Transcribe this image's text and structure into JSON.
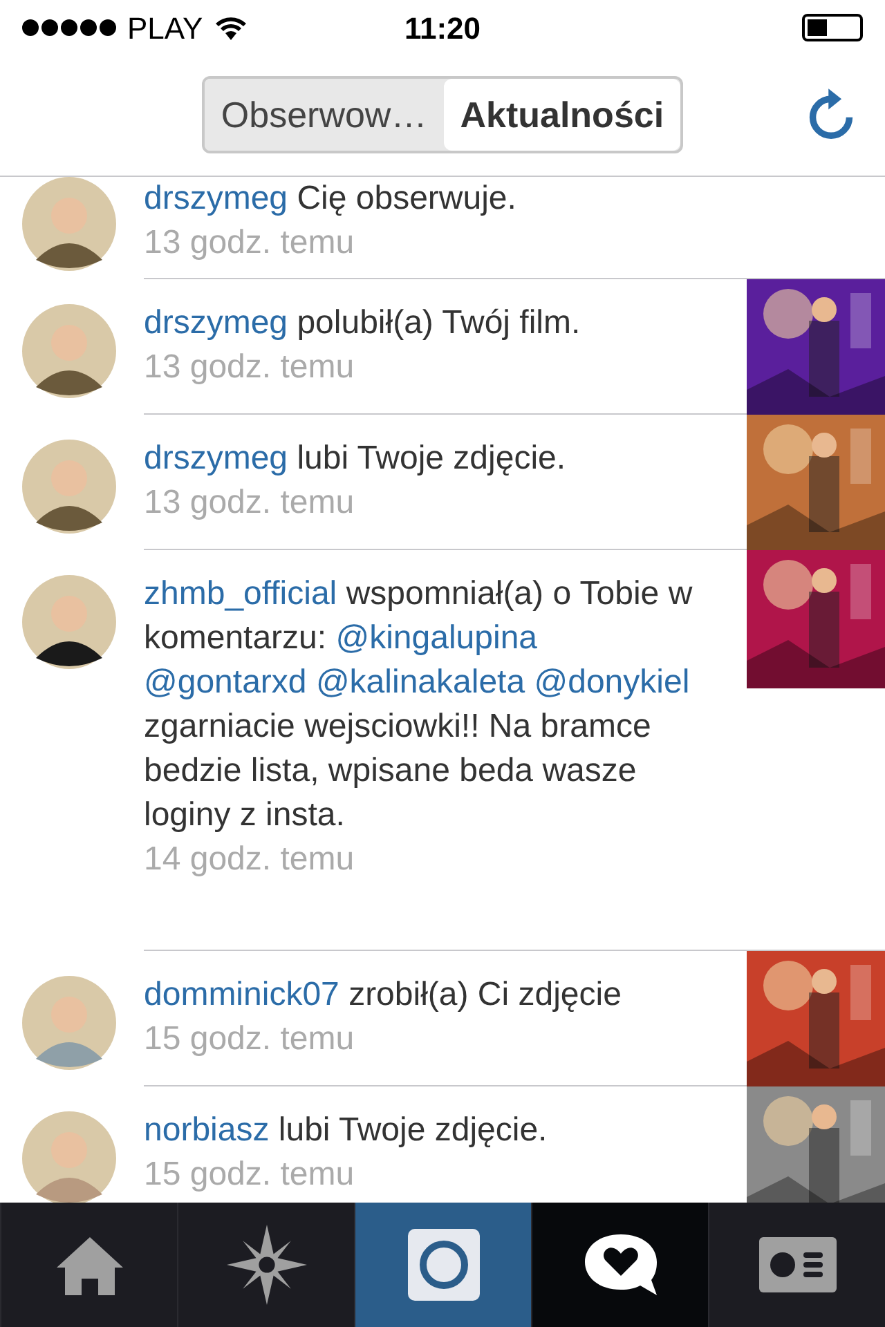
{
  "status_bar": {
    "carrier": "PLAY",
    "time": "11:20",
    "battery": {
      "level": 0.4
    }
  },
  "segments": [
    {
      "label": "Obserwow…",
      "selected": false
    },
    {
      "label": "Aktualności",
      "selected": true
    }
  ],
  "notifications": [
    {
      "user": "drszymeg",
      "action": "Cię obserwuje.",
      "time": "13 godz. temu"
    },
    {
      "user": "drszymeg",
      "action": "polubił(a) Twój film.",
      "time": "13 godz. temu",
      "thumbnail": {
        "kind": "picture"
      }
    },
    {
      "user": "drszymeg",
      "action": "lubi Twoje zdjęcie.",
      "time": "13 godz. temu",
      "thumbnail": {
        "kind": "picture"
      }
    },
    {
      "user": "zhmb_official",
      "action": "wspomniał(a) o Tobie w komentarzu:",
      "mentions": [
        "@kingalupina",
        "@gontarxd",
        "@kalinakaleta",
        "@donykiel"
      ],
      "comment": "zgarniacie wejsciowki!! Na bramce bedzie lista, wpisane beda wasze loginy z insta.",
      "time": "14 godz. temu",
      "thumbnail": {
        "kind": "picture"
      }
    },
    {
      "user": "domminick07",
      "action": "zrobił(a) Ci zdjęcie",
      "time": "15 godz. temu",
      "thumbnail": {
        "kind": "picture"
      }
    },
    {
      "user": "norbiasz",
      "action": "lubi Twoje zdjęcie.",
      "time": "15 godz. temu",
      "thumbnail": {
        "kind": "picture"
      }
    }
  ],
  "tab_bar": [
    {
      "kind": "home",
      "selected": false
    },
    {
      "kind": "explore",
      "selected": false
    },
    {
      "kind": "camera",
      "selected": false
    },
    {
      "kind": "news",
      "selected": true
    },
    {
      "kind": "profile",
      "selected": false
    }
  ]
}
